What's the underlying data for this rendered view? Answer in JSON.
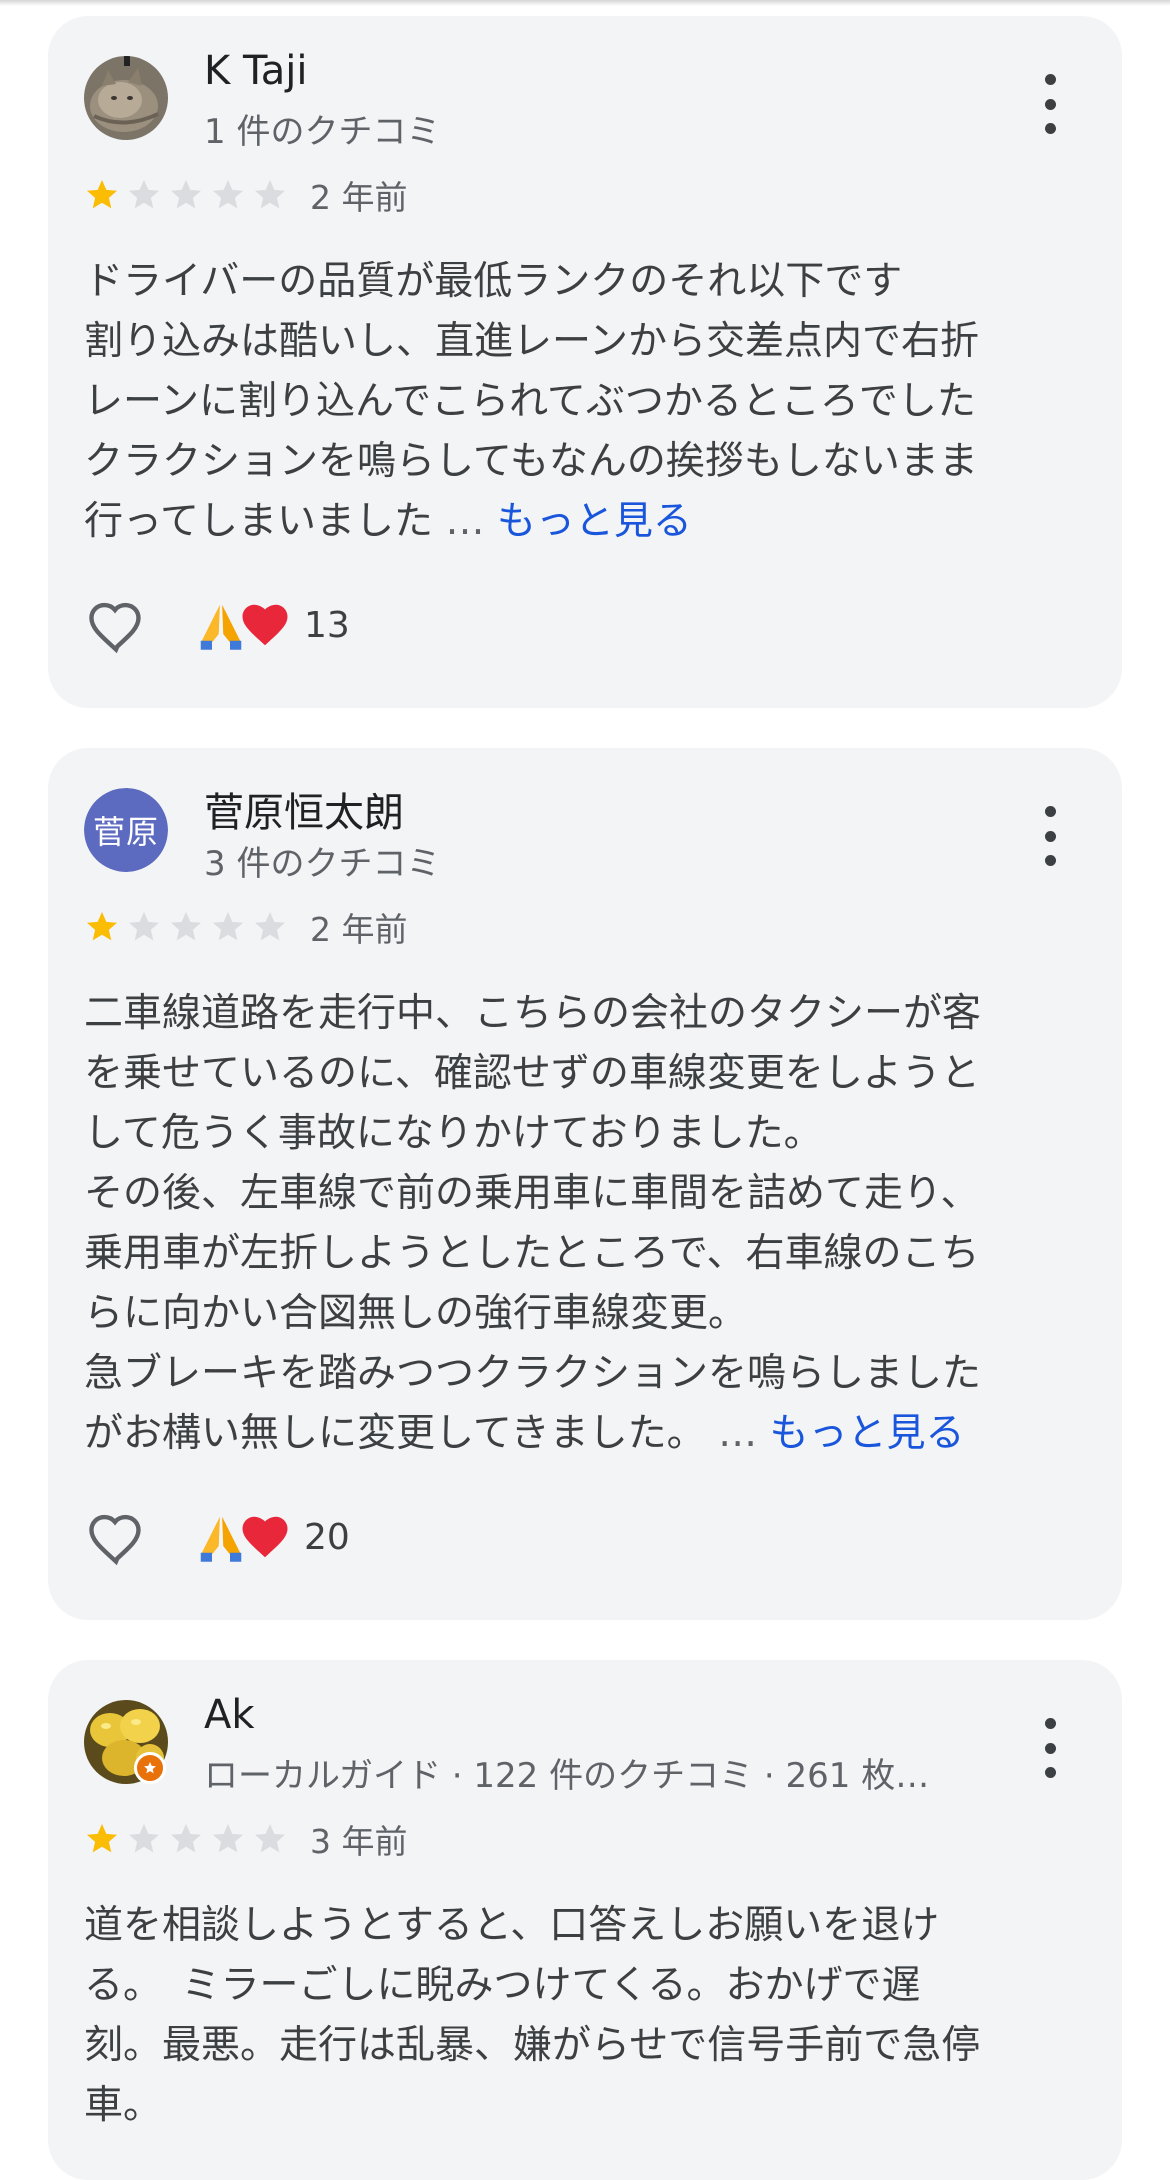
{
  "reviews": [
    {
      "name": "K Taji",
      "meta": "1 件のクチコミ",
      "avatar_type": "cat-photo",
      "stars_filled": 1,
      "stars_total": 5,
      "time": "2 年前",
      "lines": [
        "ドライバーの品質が最低ランクのそれ以下です",
        "割り込みは酷いし、直進レーンから交差点内で右折",
        "レーンに割り込んでこられてぶつかるところでした",
        "クラクションを鳴らしてもなんの挨拶もしないまま",
        "行ってしまいました"
      ],
      "ellipsis": "…",
      "more_label": "もっと見る",
      "reaction_count": "13"
    },
    {
      "name": "菅原恒太朗",
      "meta": "3 件のクチコミ",
      "avatar_initials": "菅原",
      "stars_filled": 1,
      "stars_total": 5,
      "time": "2 年前",
      "lines": [
        "二車線道路を走行中、こちらの会社のタクシーが客",
        "を乗せているのに、確認せずの車線変更をしようと",
        "して危うく事故になりかけておりました。",
        "その後、左車線で前の乗用車に車間を詰めて走り、",
        "乗用車が左折しようとしたところで、右車線のこち",
        "らに向かい合図無しの強行車線変更。",
        "急ブレーキを踏みつつクラクションを鳴らしました",
        "がお構い無しに変更してきました。"
      ],
      "ellipsis": "…",
      "more_label": "もっと見る",
      "reaction_count": "20"
    },
    {
      "name": "Ak",
      "meta": "ローカルガイド · 122 件のクチコミ · 261 枚…",
      "avatar_type": "lemon-photo",
      "stars_filled": 1,
      "stars_total": 5,
      "time": "3 年前",
      "lines": [
        "道を相談しようとすると、口答えしお願いを退け",
        "る。　ミラーごしに睨みつけてくる。おかげで遅",
        "刻。最悪。走行は乱暴、嫌がらせで信号手前で急停",
        "車。"
      ]
    }
  ],
  "colors": {
    "card_bg": "#f3f4f6",
    "star_filled": "#fbbc04",
    "star_empty": "#dadce0",
    "link": "#1a56db",
    "initials_avatar_bg": "#5c6bc0",
    "local_guide_badge": "#e8710a"
  },
  "icons": [
    "more-vert-icon",
    "heart-outline-icon",
    "folded-hands-emoji",
    "red-heart-emoji",
    "star-icon",
    "local-guide-badge-icon"
  ]
}
